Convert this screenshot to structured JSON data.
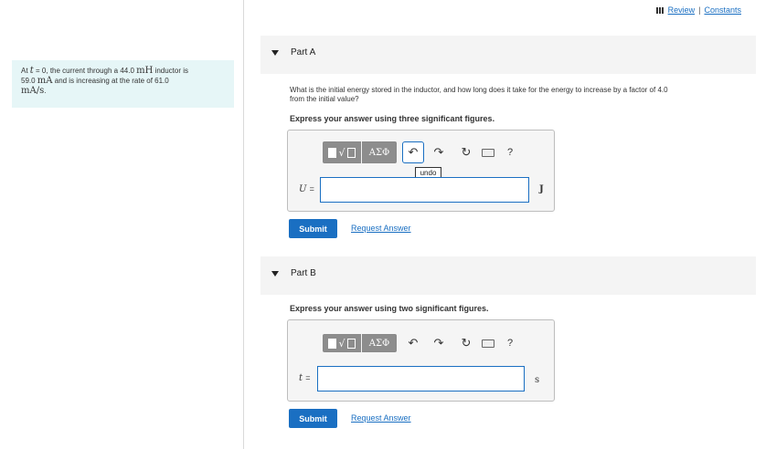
{
  "header": {
    "review_label": "Review",
    "separator": "|",
    "constants_label": "Constants"
  },
  "problem": {
    "line1_pre": "At ",
    "t_symbol": "t",
    "line1_mid": " = 0, the current through a 44.0 ",
    "unit_mh": "mH",
    "line1_post": " inductor is",
    "line2_pre": "59.0 ",
    "unit_ma": "mA",
    "line2_post": " and is increasing at the rate of 61.0",
    "line3_unit": "mA/s",
    "line3_post": "."
  },
  "partA": {
    "title": "Part A",
    "question_line1": "What is the initial energy stored in the inductor, and how long does it take for the energy to increase by a factor of 4.0",
    "question_line2": "from the initial value?",
    "instruction": "Express your answer using three significant figures.",
    "toolbar": {
      "template_label": "√□",
      "greek_label": "ΑΣΦ",
      "help_label": "?",
      "undo_tooltip": "undo"
    },
    "variable": "U",
    "equals": "=",
    "input_value": "",
    "unit": "J",
    "submit_label": "Submit",
    "request_label": "Request Answer"
  },
  "partB": {
    "title": "Part B",
    "instruction": "Express your answer using two significant figures.",
    "toolbar": {
      "template_label": "√□",
      "greek_label": "ΑΣΦ",
      "help_label": "?"
    },
    "variable": "t",
    "equals": "=",
    "input_value": "",
    "unit": "s",
    "submit_label": "Submit",
    "request_label": "Request Answer"
  },
  "colors": {
    "accent": "#1a6fc2",
    "problem_bg": "#e6f6f7",
    "part_header_bg": "#f4f4f4"
  }
}
